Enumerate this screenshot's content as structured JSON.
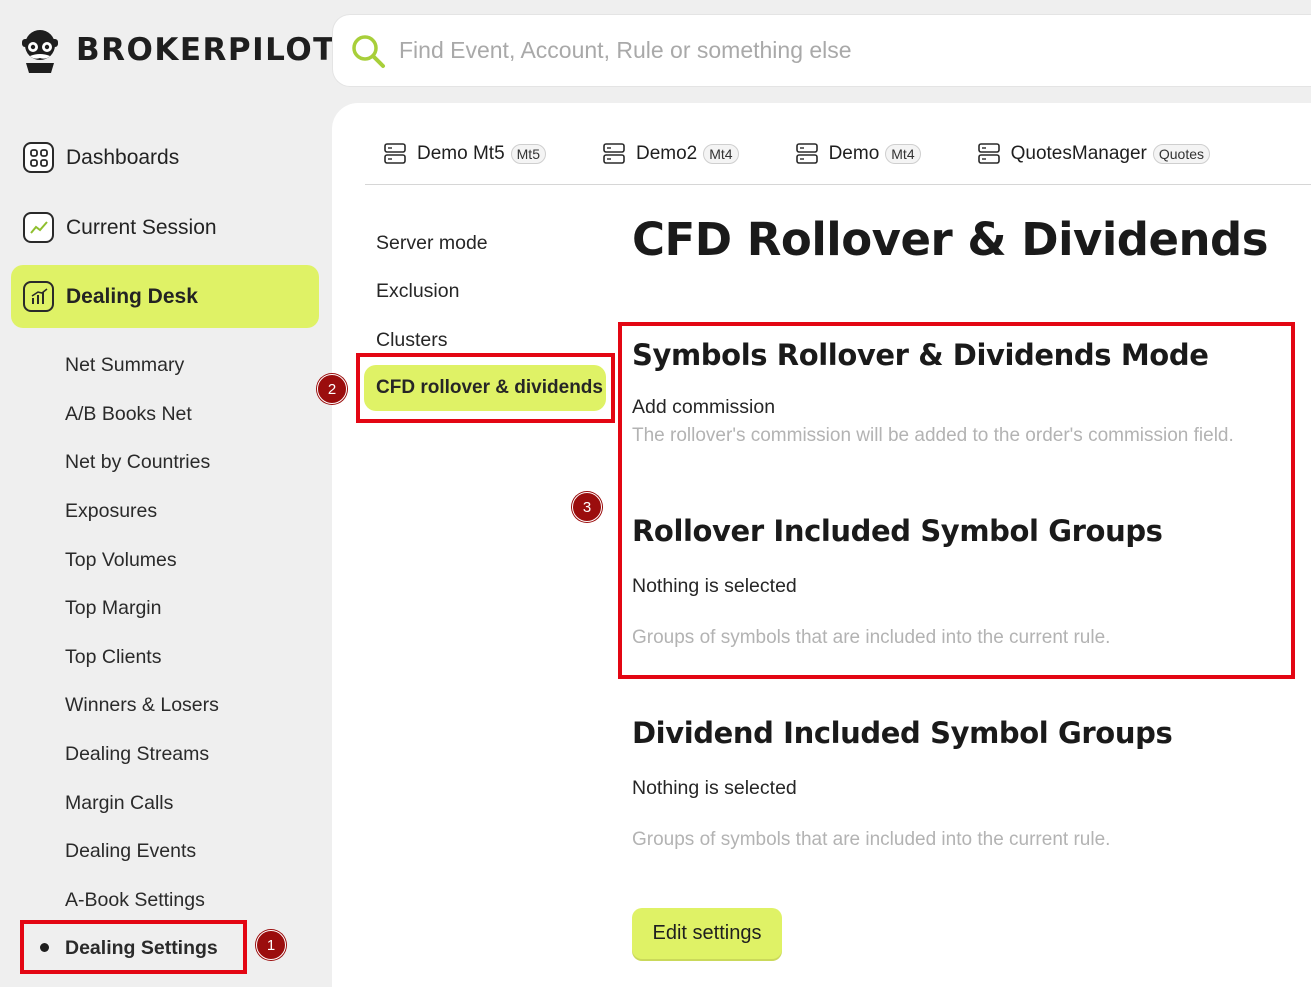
{
  "app": {
    "brand": "BROKERPILOT"
  },
  "search": {
    "placeholder": "Find Event, Account, Rule or something else"
  },
  "sidebar": {
    "items": [
      {
        "label": "Dashboards",
        "icon": "dashboards-icon"
      },
      {
        "label": "Current Session",
        "icon": "session-chart-icon"
      },
      {
        "label": "Dealing Desk",
        "icon": "dealing-desk-icon",
        "active": true
      }
    ],
    "sub_items": [
      "Net Summary",
      "A/B Books Net",
      "Net by Countries",
      "Exposures",
      "Top Volumes",
      "Top Margin",
      "Top Clients",
      "Winners & Losers",
      "Dealing Streams",
      "Margin Calls",
      "Dealing Events",
      "A-Book Settings",
      "Dealing Settings"
    ],
    "current_sub_item": "Dealing Settings"
  },
  "servers": [
    {
      "name": "Demo Mt5",
      "badge": "Mt5"
    },
    {
      "name": "Demo2",
      "badge": "Mt4"
    },
    {
      "name": "Demo",
      "badge": "Mt4"
    },
    {
      "name": "QuotesManager",
      "badge": "Quotes"
    }
  ],
  "settings_nav": [
    "Server mode",
    "Exclusion",
    "Clusters",
    "CFD rollover & dividends"
  ],
  "settings_nav_selected": "CFD rollover & dividends",
  "page": {
    "title": "CFD Rollover & Dividends",
    "sections": [
      {
        "title": "Symbols Rollover & Dividends Mode",
        "value": "Add commission",
        "description": "The rollover's commission will be added to the order's commission field."
      },
      {
        "title": "Rollover Included Symbol Groups",
        "value": "Nothing is selected",
        "description": "Groups of symbols that are included into the current rule."
      },
      {
        "title": "Dividend Included Symbol Groups",
        "value": "Nothing is selected",
        "description": "Groups of symbols that are included into the current rule."
      }
    ],
    "edit_button": "Edit settings"
  },
  "annotations": {
    "markers": [
      "1",
      "2",
      "3"
    ],
    "color": "#e30613"
  },
  "colors": {
    "accent": "#dff266",
    "background": "#efefef",
    "panel": "#ffffff"
  }
}
